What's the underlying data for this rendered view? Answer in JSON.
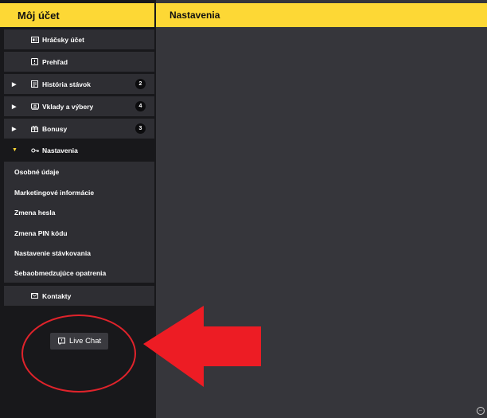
{
  "sidebar": {
    "title": "Môj účet",
    "items": [
      {
        "label": "Hráčsky účet"
      },
      {
        "label": "Prehľad"
      },
      {
        "label": "História stávok",
        "badge": "2"
      },
      {
        "label": "Vklady a výbery",
        "badge": "4"
      },
      {
        "label": "Bonusy",
        "badge": "3"
      },
      {
        "label": "Nastavenia"
      }
    ],
    "settings_sub": [
      "Osobné údaje",
      "Marketingové informácie",
      "Zmena hesla",
      "Zmena PIN kódu",
      "Nastavenie stávkovania",
      "Sebaobmedzujúce opatrenia"
    ],
    "contacts_label": "Kontakty"
  },
  "live_chat": {
    "label": "Live Chat"
  },
  "main": {
    "title": "Nastavenia"
  },
  "colors": {
    "accent": "#fdd835",
    "sidebar_bg": "#18181b",
    "panel_bg": "#36363b",
    "annotation_red": "#e0232b"
  }
}
